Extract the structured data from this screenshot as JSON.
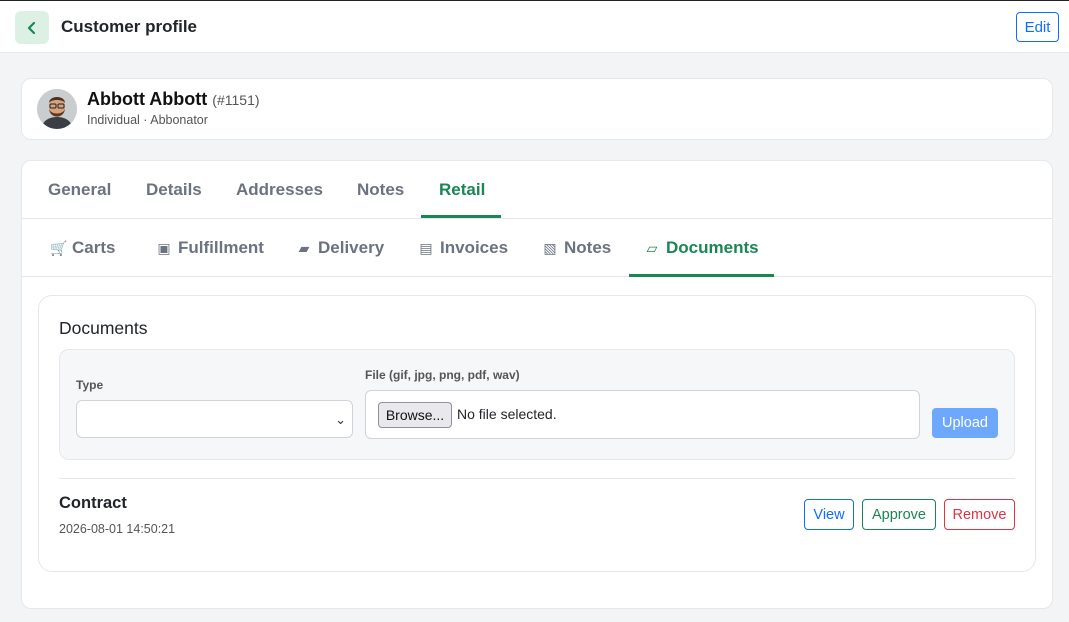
{
  "header": {
    "title": "Customer profile",
    "edit_label": "Edit"
  },
  "profile": {
    "name": "Abbott Abbott",
    "id": "(#1151)",
    "subtitle": "Individual · Abbonator"
  },
  "main_tabs": [
    {
      "label": "General",
      "active": false
    },
    {
      "label": "Details",
      "active": false
    },
    {
      "label": "Addresses",
      "active": false
    },
    {
      "label": "Notes",
      "active": false
    },
    {
      "label": "Retail",
      "active": true
    }
  ],
  "sub_tabs": [
    {
      "label": "Carts",
      "icon": "cart-icon",
      "glyph": "🛒",
      "active": false
    },
    {
      "label": "Fulfillment",
      "icon": "fulfillment-icon",
      "glyph": "▣",
      "active": false
    },
    {
      "label": "Delivery",
      "icon": "delivery-icon",
      "glyph": "▰",
      "active": false
    },
    {
      "label": "Invoices",
      "icon": "invoices-icon",
      "glyph": "▤",
      "active": false
    },
    {
      "label": "Notes",
      "icon": "notes-icon",
      "glyph": "▧",
      "active": false
    },
    {
      "label": "Documents",
      "icon": "documents-icon",
      "glyph": "▱",
      "active": true
    }
  ],
  "documents": {
    "title": "Documents",
    "type_label": "Type",
    "type_value": "",
    "file_label": "File (gif, jpg, png, pdf, wav)",
    "browse_label": "Browse...",
    "file_status": "No file selected.",
    "upload_label": "Upload",
    "items": [
      {
        "name": "Contract",
        "date": "2026-08-01 14:50:21",
        "view_label": "View",
        "approve_label": "Approve",
        "remove_label": "Remove"
      }
    ]
  },
  "colors": {
    "accent_green": "#198754",
    "primary_blue": "#0d6efd",
    "danger_red": "#dc3545",
    "upload_blue": "#6ea8fe",
    "back_button_bg": "#dcf1e3"
  }
}
